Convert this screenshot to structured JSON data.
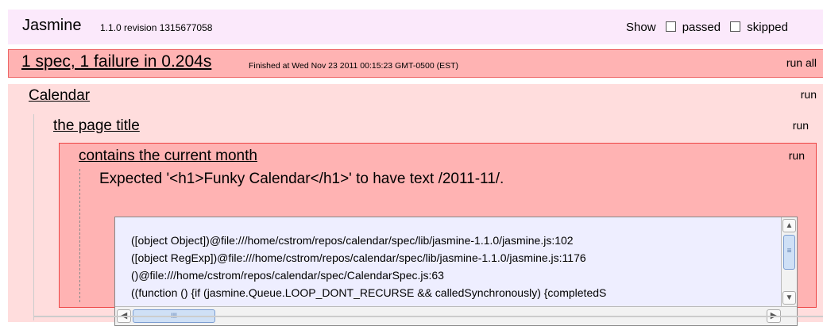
{
  "banner": {
    "logo": "Jasmine",
    "version": "1.1.0 revision 1315677058",
    "show_label": "Show",
    "passed_label": "passed",
    "skipped_label": "skipped"
  },
  "runner": {
    "description": "1 spec, 1 failure in 0.204s",
    "finished_at": "Finished at Wed Nov 23 2011 00:15:23 GMT-0500 (EST)",
    "run_all_label": "run all"
  },
  "suite": {
    "name": "Calendar",
    "run_label": "run",
    "subsuite": {
      "name": "the page title",
      "run_label": "run",
      "spec": {
        "name": "contains the current month",
        "run_label": "run",
        "message": "Expected '<h1>Funky Calendar</h1>' to have text /2011-11/.",
        "trace": [
          "([object Object])@file:///home/cstrom/repos/calendar/spec/lib/jasmine-1.1.0/jasmine.js:102",
          "([object RegExp])@file:///home/cstrom/repos/calendar/spec/lib/jasmine-1.1.0/jasmine.js:1176",
          "()@file:///home/cstrom/repos/calendar/spec/CalendarSpec.js:63",
          "((function () {if (jasmine.Queue.LOOP_DONT_RECURSE && calledSynchronously) {completedS"
        ]
      }
    }
  },
  "scrollbar": {
    "thumb_grip": "≡",
    "hthumb_grip": "III"
  },
  "colors": {
    "banner_bg": "#fbe9fb",
    "failure_bg": "#ffb3b3",
    "suite_bg": "#ffdddd"
  }
}
